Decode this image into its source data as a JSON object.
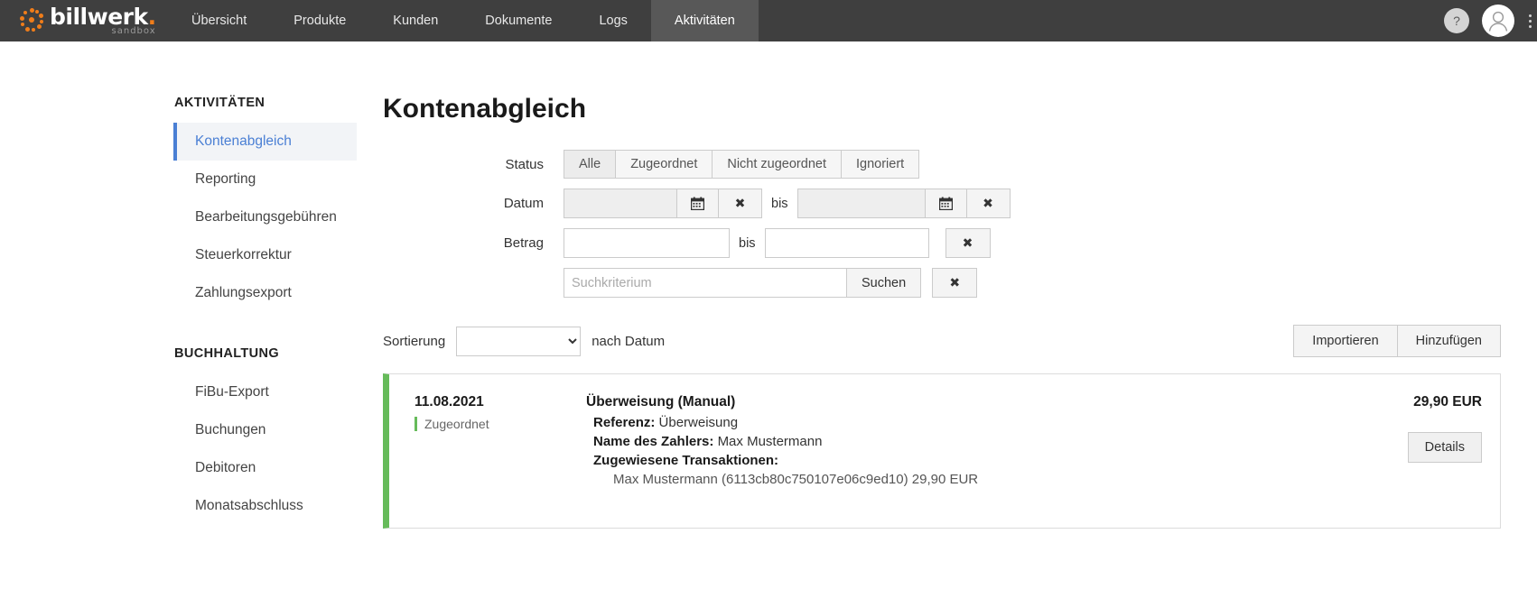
{
  "brand": {
    "name": "billwerk",
    "dot": ".",
    "sub": "sandbox"
  },
  "nav": {
    "items": [
      {
        "label": "Übersicht",
        "active": false
      },
      {
        "label": "Produkte",
        "active": false
      },
      {
        "label": "Kunden",
        "active": false
      },
      {
        "label": "Dokumente",
        "active": false
      },
      {
        "label": "Logs",
        "active": false
      },
      {
        "label": "Aktivitäten",
        "active": true
      }
    ],
    "help_label": "?"
  },
  "sidebar": {
    "sections": [
      {
        "title": "AKTIVITÄTEN",
        "items": [
          {
            "label": "Kontenabgleich",
            "active": true
          },
          {
            "label": "Reporting",
            "active": false
          },
          {
            "label": "Bearbeitungsgebühren",
            "active": false
          },
          {
            "label": "Steuerkorrektur",
            "active": false
          },
          {
            "label": "Zahlungsexport",
            "active": false
          }
        ]
      },
      {
        "title": "BUCHHALTUNG",
        "items": [
          {
            "label": "FiBu-Export",
            "active": false
          },
          {
            "label": "Buchungen",
            "active": false
          },
          {
            "label": "Debitoren",
            "active": false
          },
          {
            "label": "Monatsabschluss",
            "active": false
          }
        ]
      }
    ]
  },
  "main": {
    "title": "Kontenabgleich",
    "filters": {
      "status": {
        "label": "Status",
        "options": [
          {
            "label": "Alle",
            "active": true
          },
          {
            "label": "Zugeordnet",
            "active": false
          },
          {
            "label": "Nicht zugeordnet",
            "active": false
          },
          {
            "label": "Ignoriert",
            "active": false
          }
        ]
      },
      "date": {
        "label": "Datum",
        "from_value": "",
        "to_value": "",
        "between_label": "bis",
        "calendar_icon": "calendar-icon",
        "clear_icon": "✖"
      },
      "amount": {
        "label": "Betrag",
        "from_value": "",
        "to_value": "",
        "between_label": "bis",
        "clear_icon": "✖"
      },
      "search": {
        "placeholder": "Suchkriterium",
        "value": "",
        "button_label": "Suchen",
        "clear_icon": "✖"
      }
    },
    "sort": {
      "label": "Sortierung",
      "selected": "",
      "options": [
        ""
      ],
      "after_label": "nach Datum",
      "import_label": "Importieren",
      "add_label": "Hinzufügen"
    },
    "transactions": [
      {
        "date": "11.08.2021",
        "status": "Zugeordnet",
        "heading": "Überweisung (Manual)",
        "reference_label": "Referenz:",
        "reference_value": "Überweisung",
        "payer_label": "Name des Zahlers:",
        "payer_value": "Max Mustermann",
        "assigned_label": "Zugewiesene Transaktionen:",
        "assigned_value": "Max Mustermann (6113cb80c750107e06c9ed10) 29,90 EUR",
        "amount": "29,90 EUR",
        "details_label": "Details"
      }
    ]
  },
  "colors": {
    "header_bg": "#3f3f3f",
    "header_active": "#585858",
    "accent_orange": "#f07d1a",
    "accent_blue": "#4a7fd4",
    "status_green": "#66bb5a"
  }
}
